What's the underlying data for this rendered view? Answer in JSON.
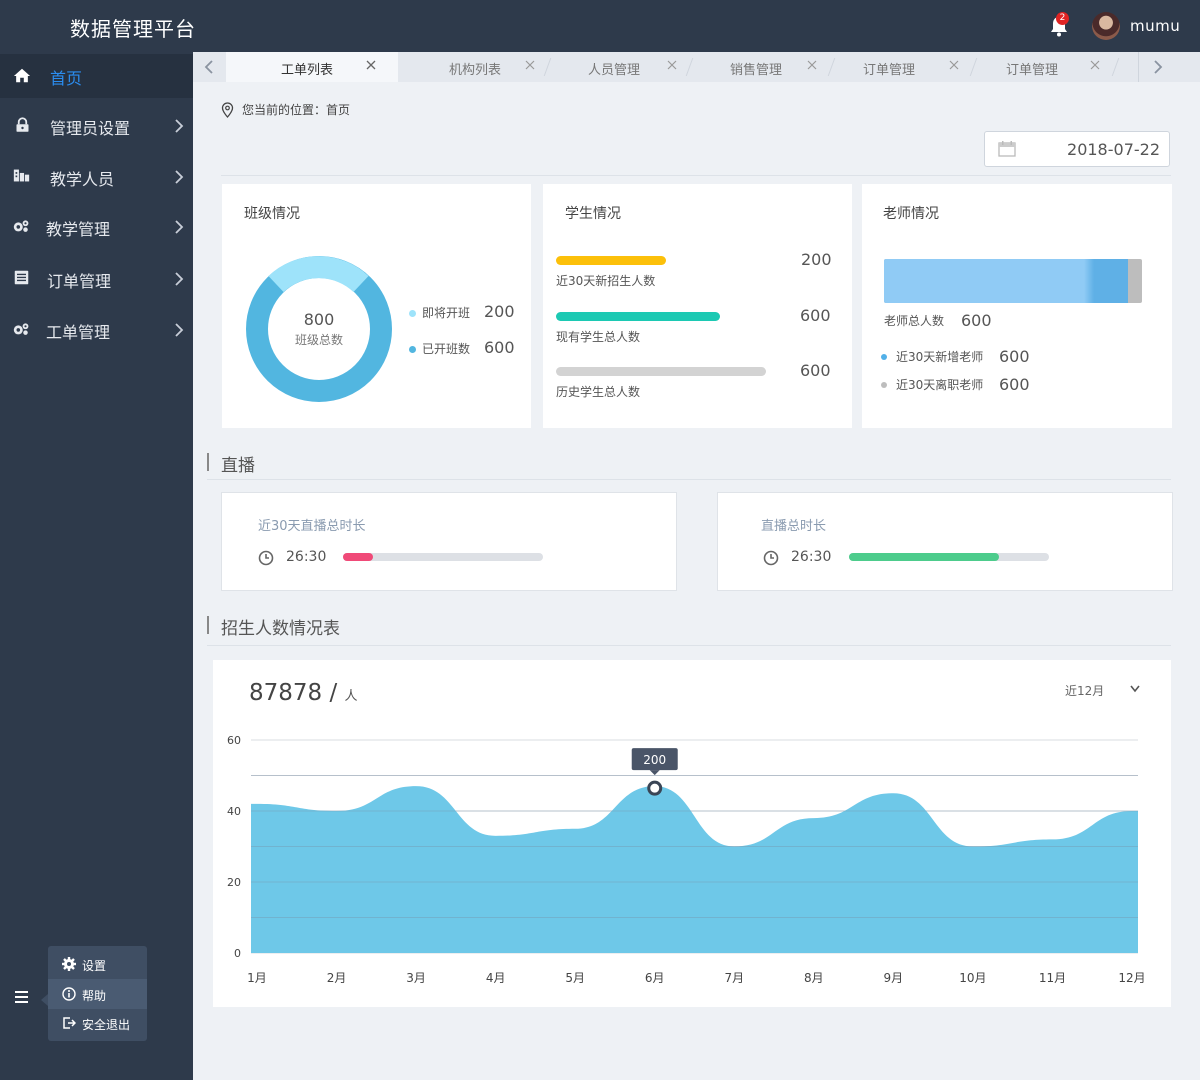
{
  "header": {
    "app_title": "数据管理平台",
    "notification_count": "2",
    "username": "mumu"
  },
  "sidebar": {
    "items": [
      {
        "label": "首页",
        "icon": "home-icon",
        "active": true
      },
      {
        "label": "管理员设置",
        "icon": "lock-icon"
      },
      {
        "label": "教学人员",
        "icon": "building-icon"
      },
      {
        "label": "教学管理",
        "icon": "gears-icon"
      },
      {
        "label": "订单管理",
        "icon": "list-icon"
      },
      {
        "label": "工单管理",
        "icon": "gears-icon"
      }
    ],
    "popup": [
      {
        "label": "设置",
        "icon": "gear-icon"
      },
      {
        "label": "帮助",
        "icon": "info-icon"
      },
      {
        "label": "安全退出",
        "icon": "logout-icon"
      }
    ]
  },
  "tabs": [
    {
      "label": "工单列表",
      "active": true
    },
    {
      "label": "机构列表"
    },
    {
      "label": "人员管理"
    },
    {
      "label": "销售管理"
    },
    {
      "label": "订单管理"
    },
    {
      "label": "订单管理"
    }
  ],
  "breadcrumb": "您当前的位置：首页",
  "date_picker": {
    "value": "2018-07-22"
  },
  "class_card": {
    "title": "班级情况",
    "total": "800",
    "total_label": "班级总数",
    "legend": [
      {
        "label": "即将开班",
        "value": "200",
        "color": "#9ee3fa"
      },
      {
        "label": "已开班数",
        "value": "600",
        "color": "#52b6e0"
      }
    ]
  },
  "student_card": {
    "title": "学生情况",
    "rows": [
      {
        "label": "近30天新招生人数",
        "value": "200",
        "color": "#fcc00a",
        "fill": 0.52
      },
      {
        "label": "现有学生总人数",
        "value": "600",
        "color": "#1cc9b3",
        "fill": 0.78
      },
      {
        "label": "历史学生总人数",
        "value": "600",
        "color": "#d3d3d3",
        "fill": 1.0
      }
    ]
  },
  "teacher_card": {
    "title": "老师情况",
    "total_label": "老师总人数",
    "total": "600",
    "legend": [
      {
        "label": "近30天新增老师",
        "value": "600",
        "color": "#52b0e8"
      },
      {
        "label": "近30天离职老师",
        "value": "600",
        "color": "#bdbdbd"
      }
    ]
  },
  "live_section": {
    "title": "直播",
    "cards": [
      {
        "label": "近30天直播总时长",
        "time": "26:30",
        "fill": 0.15,
        "color": "#f04a78"
      },
      {
        "label": "直播总时长",
        "time": "26:30",
        "fill": 0.75,
        "color": "#4dcc8c"
      }
    ]
  },
  "enroll_section": {
    "title": "招生人数情况表",
    "total": "87878",
    "unit": "人",
    "range": "近12月"
  },
  "chart_data": {
    "type": "area",
    "categories": [
      "1月",
      "2月",
      "3月",
      "4月",
      "5月",
      "6月",
      "7月",
      "8月",
      "9月",
      "10月",
      "11月",
      "12月"
    ],
    "y_ticks": [
      "0",
      "20",
      "40",
      "60"
    ],
    "ylim": [
      0,
      60
    ],
    "series": [
      {
        "values": [
          42,
          40,
          47,
          33,
          35,
          47,
          30,
          38,
          45,
          30,
          32,
          40
        ],
        "color": "#6ec8e8"
      }
    ],
    "peaks": [
      47,
      47,
      45,
      49
    ],
    "highlight": {
      "index": 5,
      "value": 47,
      "label": "200"
    },
    "grid": true
  }
}
